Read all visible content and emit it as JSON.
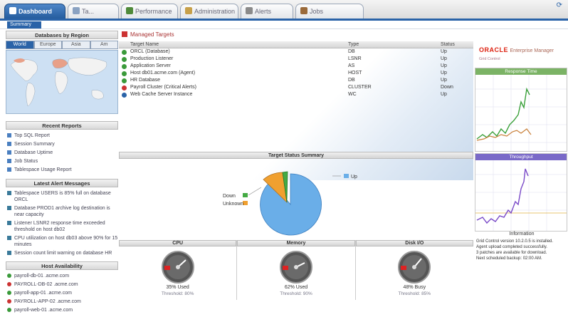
{
  "tabs": [
    {
      "label": "Dashboard",
      "active": true,
      "color": "#2a63a8"
    },
    {
      "label": "Ta...",
      "active": false,
      "color": "#8aa2c2"
    },
    {
      "label": "Performance",
      "active": false,
      "color": "#4f8a3a"
    },
    {
      "label": "Administration",
      "active": false,
      "color": "#c7a04a"
    },
    {
      "label": "Alerts",
      "active": false,
      "color": "#8a8a8a"
    },
    {
      "label": "Jobs",
      "active": false,
      "color": "#9a6a3a"
    }
  ],
  "subnav": {
    "selected": "Summary"
  },
  "left": {
    "regions_title": "Databases by Region",
    "region_tabs": [
      "World",
      "Europe",
      "Asia",
      "Am"
    ],
    "recent_title": "Recent Reports",
    "recent": [
      "Top SQL Report",
      "Session Summary",
      "Database Uptime",
      "Job Status",
      "Tablespace Usage Report"
    ],
    "alerts_title": "Latest Alert Messages",
    "alerts": [
      "Tablespace USERS is 85% full on database ORCL",
      "Database PROD1 archive log destination is near capacity",
      "Listener LSNR2 response time exceeded threshold on host db02",
      "CPU utilization on host db03 above 90% for 15 minutes",
      "Session count limit warning on database HR"
    ],
    "hosts_title": "Host Availability",
    "hosts": [
      {
        "label": "payroll-db-01 .acme.com",
        "ok": true
      },
      {
        "label": "PAYROLL-DB-02 .acme.com",
        "ok": false
      },
      {
        "label": "payroll-app-01 .acme.com",
        "ok": true
      },
      {
        "label": "PAYROLL-APP-02 .acme.com",
        "ok": false
      },
      {
        "label": "payroll-web-01 .acme.com",
        "ok": true
      }
    ]
  },
  "main": {
    "title": "Managed Targets",
    "columns": [
      "Target Name",
      "Type",
      "Status"
    ],
    "rows": [
      {
        "name": "ORCL (Database)",
        "type": "DB",
        "value": "Up",
        "status": "#3a9a3a"
      },
      {
        "name": "Production Listener",
        "type": "LSNR",
        "value": "Up",
        "status": "#3a9a3a"
      },
      {
        "name": "Application Server",
        "type": "AS",
        "value": "Up",
        "status": "#3a9a3a"
      },
      {
        "name": "Host db01.acme.com (Agent)",
        "type": "HOST",
        "value": "Up",
        "status": "#3a9a3a"
      },
      {
        "name": "HR Database",
        "type": "DB",
        "value": "Up",
        "status": "#3a9a3a"
      },
      {
        "name": "Payroll Cluster (Critical Alerts)",
        "type": "CLUSTER",
        "value": "Down",
        "status": "#c33"
      },
      {
        "name": "Web Cache Server Instance",
        "type": "WC",
        "value": "Up",
        "status": "#2a63a8"
      }
    ],
    "pie_title": "Target Status Summary",
    "pie_legend": [
      {
        "label": "Up",
        "color": "#6aaee8"
      },
      {
        "label": "Down",
        "color": "#44aa44"
      },
      {
        "label": "Unknown",
        "color": "#f0a030"
      }
    ],
    "gauges": [
      {
        "title": "CPU",
        "value": "35% Used",
        "sub": "Threshold: 80%"
      },
      {
        "title": "Memory",
        "value": "62% Used",
        "sub": "Threshold: 90%"
      },
      {
        "title": "Disk I/O",
        "value": "48% Busy",
        "sub": "Threshold: 85%"
      }
    ]
  },
  "right": {
    "brand": "ORACLE",
    "brand_sub": "Enterprise Manager",
    "brand_tag": "Grid Control",
    "chart1_title": "Response Time",
    "chart2_title": "Throughput",
    "info_title": "Information",
    "info_lines": [
      "Grid Control version 10.2.0.5 is installed.",
      "Agent upload completed successfully.",
      "3 patches are available for download.",
      "Next scheduled backup: 02:00 AM."
    ]
  }
}
